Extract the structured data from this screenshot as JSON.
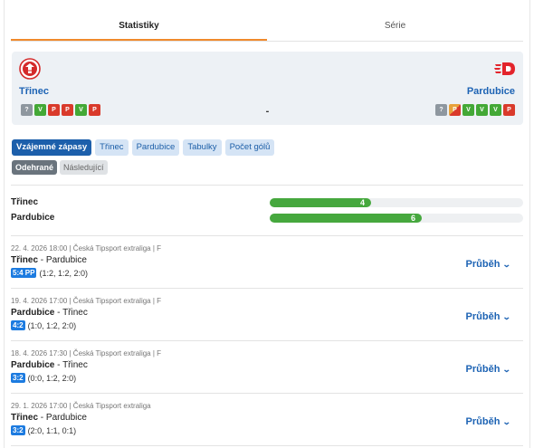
{
  "tabs": [
    {
      "label": "Statistiky",
      "active": true
    },
    {
      "label": "Série",
      "active": false
    }
  ],
  "match": {
    "home": {
      "name": "Třinec",
      "form": [
        "?",
        "V",
        "P",
        "P",
        "V",
        "P"
      ]
    },
    "away": {
      "name": "Pardubice",
      "form": [
        "?",
        "P",
        "V",
        "V",
        "V",
        "P"
      ]
    },
    "score": "-"
  },
  "filters": [
    {
      "label": "Vzájemné zápasy",
      "active": true
    },
    {
      "label": "Třinec",
      "active": false
    },
    {
      "label": "Pardubice",
      "active": false
    },
    {
      "label": "Tabulky",
      "active": false
    },
    {
      "label": "Počet gólů",
      "active": false
    }
  ],
  "subfilters": [
    {
      "label": "Odehrané",
      "active": true
    },
    {
      "label": "Následující",
      "active": false
    }
  ],
  "wins": [
    {
      "team": "Třinec",
      "value": "4",
      "fraction": 0.4
    },
    {
      "team": "Pardubice",
      "value": "6",
      "fraction": 0.6
    }
  ],
  "games": [
    {
      "meta": "22. 4. 2026 18:00 | Česká Tipsport extraliga | F",
      "home": "Třinec",
      "away": "Pardubice",
      "winner": "home",
      "score": "5:4 PP",
      "periods": "(1:2, 1:2, 2:0)",
      "action": "Průběh"
    },
    {
      "meta": "19. 4. 2026 17:00 | Česká Tipsport extraliga | F",
      "home": "Pardubice",
      "away": "Třinec",
      "winner": "home",
      "score": "4:2",
      "periods": "(1:0, 1:2, 2:0)",
      "action": "Průběh"
    },
    {
      "meta": "18. 4. 2026 17:30 | Česká Tipsport extraliga | F",
      "home": "Pardubice",
      "away": "Třinec",
      "winner": "home",
      "score": "3:2",
      "periods": "(0:0, 1:2, 2:0)",
      "action": "Průběh"
    },
    {
      "meta": "29. 1. 2026 17:00 | Česká Tipsport extraliga",
      "home": "Třinec",
      "away": "Pardubice",
      "winner": "home",
      "score": "3:2",
      "periods": "(2:0, 1:1, 0:1)",
      "action": "Průběh"
    }
  ],
  "colors": {
    "accent": "#1d63b4",
    "tab_underline": "#f08a2c",
    "win": "#43a836",
    "loss": "#d93a2b",
    "bar": "#46a83e"
  },
  "icons": {
    "home_logo": "hc-trinec-logo",
    "away_logo": "hc-pardubice-logo",
    "expand": "chevron-down-icon"
  }
}
